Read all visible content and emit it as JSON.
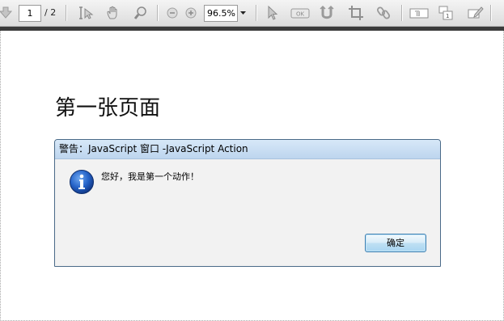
{
  "toolbar": {
    "current_page": "1",
    "page_total": "/ 2",
    "zoom_level": "96.5%",
    "icons": [
      "page-down-icon",
      "text-select-icon",
      "hand-tool-icon",
      "zoom-tool-icon",
      "zoom-out-icon",
      "zoom-in-icon",
      "select-arrow-icon",
      "ok-button-tool-icon",
      "loop-tool-icon",
      "crop-tool-icon",
      "link-tool-icon",
      "text-field-icon",
      "form-field-icon",
      "sign-icon"
    ]
  },
  "document": {
    "heading": "第一张页面"
  },
  "dialog": {
    "title": "警告：JavaScript 窗口 -JavaScript Action",
    "message": "您好，我是第一个动作！",
    "ok_label": "确定",
    "icon": "info-icon"
  },
  "colors": {
    "toolbar_bottom_bar": "#3b3b3b",
    "dialog_title_bg": "#c8dcf1",
    "button_border": "#3c7fb1",
    "info_icon_blue": "#1f5fbf"
  }
}
